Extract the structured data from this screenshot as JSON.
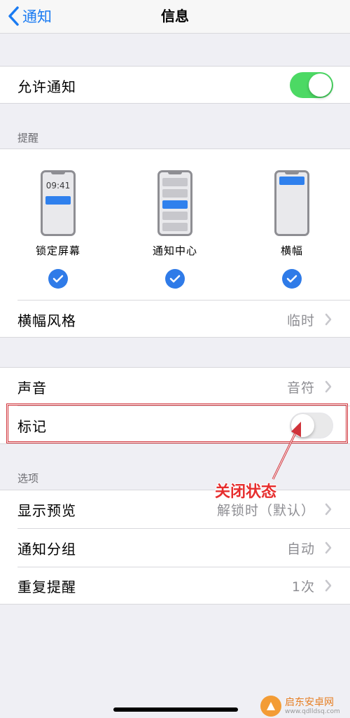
{
  "navbar": {
    "back_label": "通知",
    "title": "信息"
  },
  "allow": {
    "label": "允许通知",
    "enabled": true
  },
  "alerts": {
    "header": "提醒",
    "options": [
      {
        "label": "锁定屏幕",
        "time": "09:41",
        "checked": true
      },
      {
        "label": "通知中心",
        "checked": true
      },
      {
        "label": "横幅",
        "checked": true
      }
    ],
    "banner_style": {
      "label": "横幅风格",
      "value": "临时"
    }
  },
  "sound": {
    "label": "声音",
    "value": "音符"
  },
  "badges": {
    "label": "标记",
    "enabled": false
  },
  "options": {
    "header": "选项",
    "items": [
      {
        "label": "显示预览",
        "value": "解锁时（默认）"
      },
      {
        "label": "通知分组",
        "value": "自动"
      },
      {
        "label": "重复提醒",
        "value": "1次"
      }
    ]
  },
  "annotation": {
    "text": "关闭状态"
  },
  "watermark": {
    "name": "启东安卓网",
    "url": "www.qdlldsq.com"
  },
  "colors": {
    "accent": "#1a7bf2",
    "toggle_on": "#4cd964",
    "annotation": "#e62e2e"
  }
}
